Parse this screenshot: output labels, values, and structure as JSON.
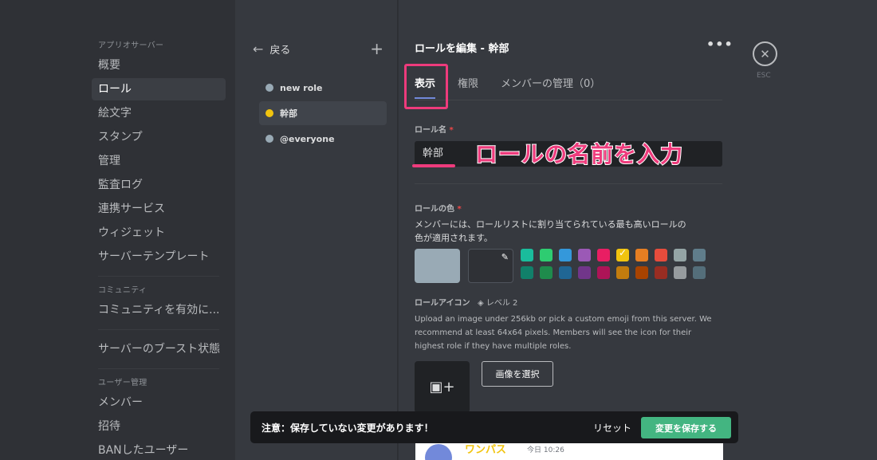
{
  "window": {
    "controls": [
      {
        "name": "close",
        "color": "#ff5f57"
      },
      {
        "name": "minimize",
        "color": "#febc2e"
      },
      {
        "name": "zoom",
        "color": "#28c840"
      }
    ]
  },
  "sidebar": {
    "section_app": "アプリオサーバー",
    "items_app": [
      "概要",
      "ロール",
      "絵文字",
      "スタンプ",
      "管理",
      "監査ログ",
      "連携サービス",
      "ウィジェット",
      "サーバーテンプレート"
    ],
    "active_index": 1,
    "section_community": "コミュニティ",
    "items_community": [
      "コミュニティを有効に..."
    ],
    "item_boost": "サーバーのブースト状態",
    "section_users": "ユーザー管理",
    "items_users": [
      "メンバー",
      "招待",
      "BANしたユーザー"
    ]
  },
  "roles_panel": {
    "back_label": "戻る",
    "add_icon": "plus-icon",
    "roles": [
      {
        "name": "new role",
        "color": "#99aab5"
      },
      {
        "name": "幹部",
        "color": "#f1c40f"
      },
      {
        "name": "@everyone",
        "color": "#99aab5"
      }
    ],
    "active_index": 1
  },
  "editor": {
    "title": "ロールを編集 - 幹部",
    "more_icon": "ellipsis-icon",
    "close_icon": "close-icon",
    "esc_label": "ESC",
    "tabs": [
      "表示",
      "権限",
      "メンバーの管理（0）"
    ],
    "active_tab": 0,
    "role_name_label": "ロール名",
    "role_name_value": "幹部",
    "annotation": "ロールの名前を入力",
    "role_color_label": "ロールの色",
    "role_color_desc_1": "メンバーには、ロールリストに割り当てられている最も高いロールの",
    "role_color_desc_2": "色が適用されます。",
    "default_color": "#99aab5",
    "eyedropper_icon": "eyedropper-icon",
    "swatches_row1": [
      "#1abc9c",
      "#2ecc71",
      "#3498db",
      "#9b59b6",
      "#e91e63",
      "#f1c40f",
      "#e67e22",
      "#e74c3c",
      "#95a5a6",
      "#607d8b"
    ],
    "swatches_row2": [
      "#11806a",
      "#1f8b4c",
      "#206694",
      "#71368a",
      "#ad1457",
      "#c27c0e",
      "#a84300",
      "#992d22",
      "#979c9f",
      "#546e7a"
    ],
    "selected_swatch": "#f1c40f",
    "role_icon_label": "ロールアイコン",
    "level_badge": "レベル 2",
    "role_icon_desc_1": "Upload an image under 256kb or pick a custom emoji from this server. We",
    "role_icon_desc_2": "recommend at least 64x64 pixels. Members will see the icon for their",
    "role_icon_desc_3": "highest role if they have multiple roles.",
    "upload_icon": "image-plus-icon",
    "choose_image_label": "画像を選択",
    "preview_name": "ワンパス",
    "preview_time": "今日 10:26"
  },
  "notice_bar": {
    "message": "注意：保存していない変更があります！",
    "reset_label": "リセット",
    "save_label": "変更を保存する"
  }
}
